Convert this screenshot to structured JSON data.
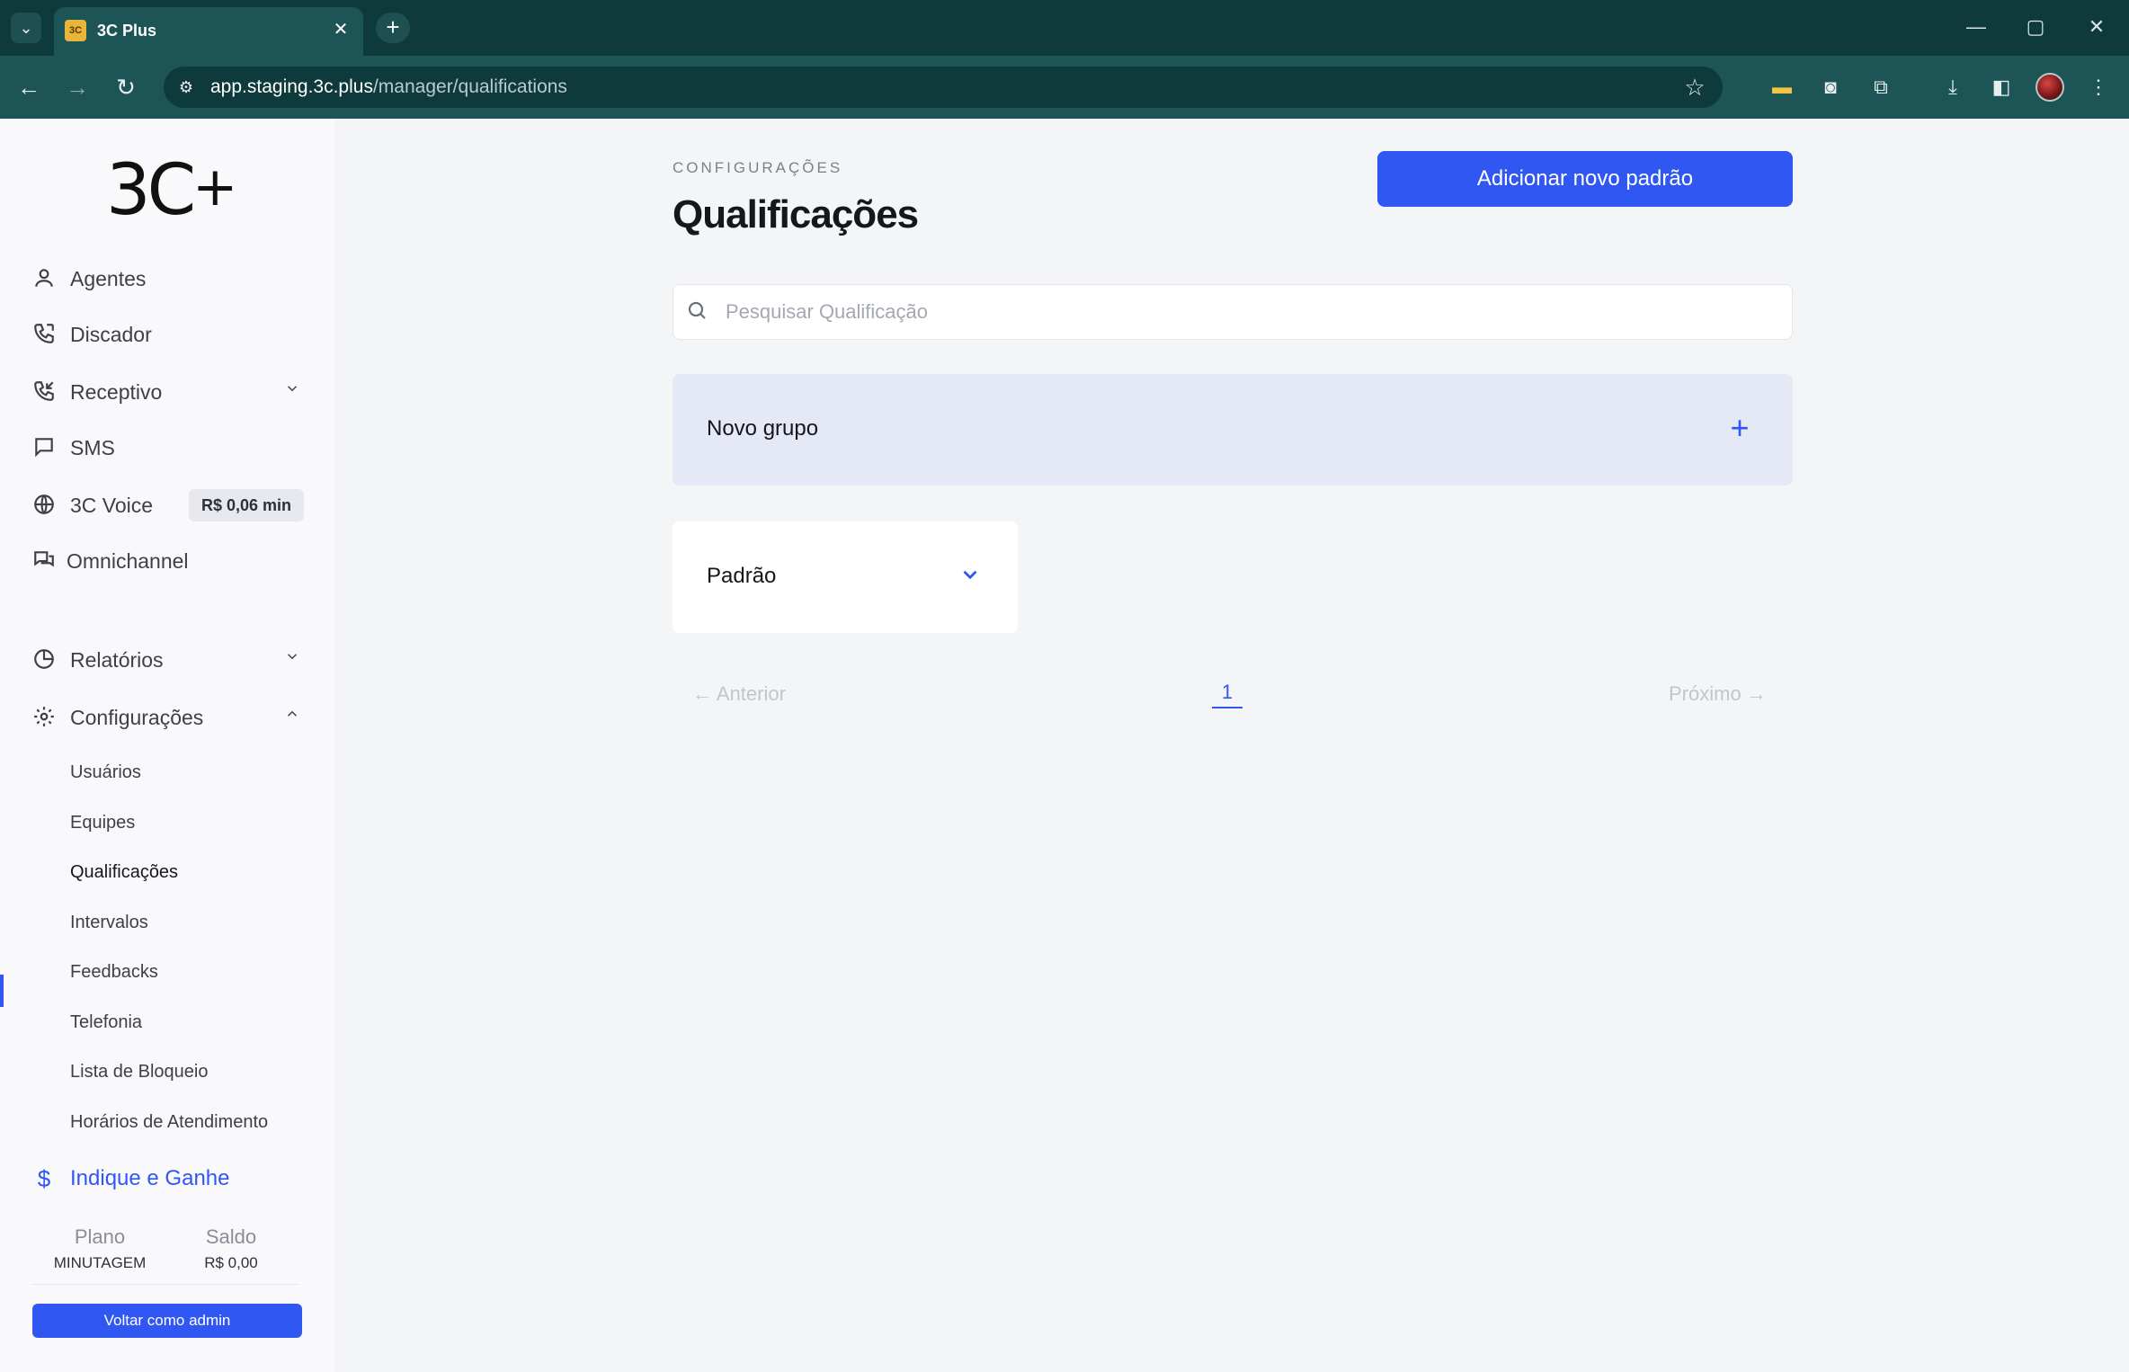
{
  "browser": {
    "tab_title": "3C Plus",
    "favicon_text": "3C",
    "url_domain": "app.staging.3c.plus",
    "url_path": "/manager/qualifications"
  },
  "sidebar": {
    "logo": "3C+",
    "items": [
      {
        "label": "Agentes",
        "icon": "user-icon"
      },
      {
        "label": "Discador",
        "icon": "phone-icon"
      },
      {
        "label": "Receptivo",
        "icon": "phone-incoming-icon"
      },
      {
        "label": "SMS",
        "icon": "message-icon"
      },
      {
        "label": "3C Voice",
        "icon": "globe-icon",
        "badge": "R$ 0,06 min"
      },
      {
        "label": "Omnichannel",
        "icon": "chat-icon"
      },
      {
        "label": "Relatórios",
        "icon": "pie-chart-icon"
      },
      {
        "label": "Configurações",
        "icon": "gear-icon"
      }
    ],
    "submenu": [
      "Usuários",
      "Equipes",
      "Qualificações",
      "Intervalos",
      "Feedbacks",
      "Telefonia",
      "Lista de Bloqueio",
      "Horários de Atendimento"
    ],
    "active_submenu": "Qualificações",
    "indique": "Indique e Ganhe",
    "plan_title": "Plano",
    "plan_value": "MINUTAGEM",
    "balance_title": "Saldo",
    "balance_value": "R$ 0,00",
    "admin_button": "Voltar como admin"
  },
  "main": {
    "eyebrow": "CONFIGURAÇÕES",
    "title": "Qualificações",
    "add_button": "Adicionar novo padrão",
    "search_placeholder": "Pesquisar Qualificação",
    "new_group": "Novo grupo",
    "default_group": "Padrão",
    "pagination": {
      "prev": "← Anterior",
      "current": "1",
      "next": "Próximo →"
    }
  },
  "colors": {
    "accent": "#3057f2",
    "chrome": "#1d5456"
  }
}
